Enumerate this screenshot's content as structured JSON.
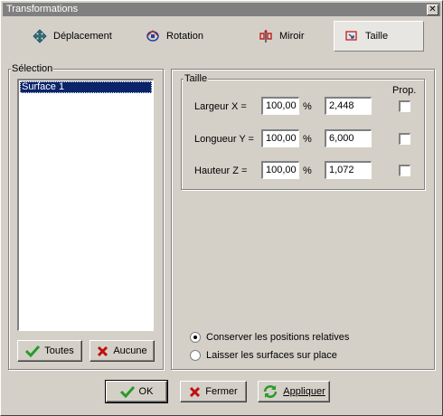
{
  "window": {
    "title": "Transformations",
    "close_label": "✕"
  },
  "tabs": [
    {
      "label": "Déplacement",
      "icon": "move-icon"
    },
    {
      "label": "Rotation",
      "icon": "rotation-icon"
    },
    {
      "label": "Miroir",
      "icon": "mirror-icon"
    },
    {
      "label": "Taille",
      "icon": "scale-icon",
      "active": true
    }
  ],
  "selection": {
    "legend": "Sélection",
    "items": [
      "Surface 1"
    ],
    "all_button": "Toutes",
    "none_button": "Aucune"
  },
  "size": {
    "legend": "Taille",
    "prop_header": "Prop.",
    "percent_unit": "%",
    "rows": [
      {
        "label": "Largeur X =",
        "percent": "100,00",
        "value": "2,448",
        "prop_checked": false
      },
      {
        "label": "Longueur Y =",
        "percent": "100,00",
        "value": "6,000",
        "prop_checked": false
      },
      {
        "label": "Hauteur Z =",
        "percent": "100,00",
        "value": "1,072",
        "prop_checked": false
      }
    ]
  },
  "options": {
    "keep_relative": "Conserver les positions relatives",
    "leave_in_place": "Laisser les surfaces sur place",
    "selected": "keep_relative"
  },
  "footer": {
    "ok": "OK",
    "close": "Fermer",
    "apply": "Appliquer"
  },
  "colors": {
    "check_green": "#2a9a2a",
    "cross_red": "#c01010",
    "selection_blue": "#0a246a"
  }
}
